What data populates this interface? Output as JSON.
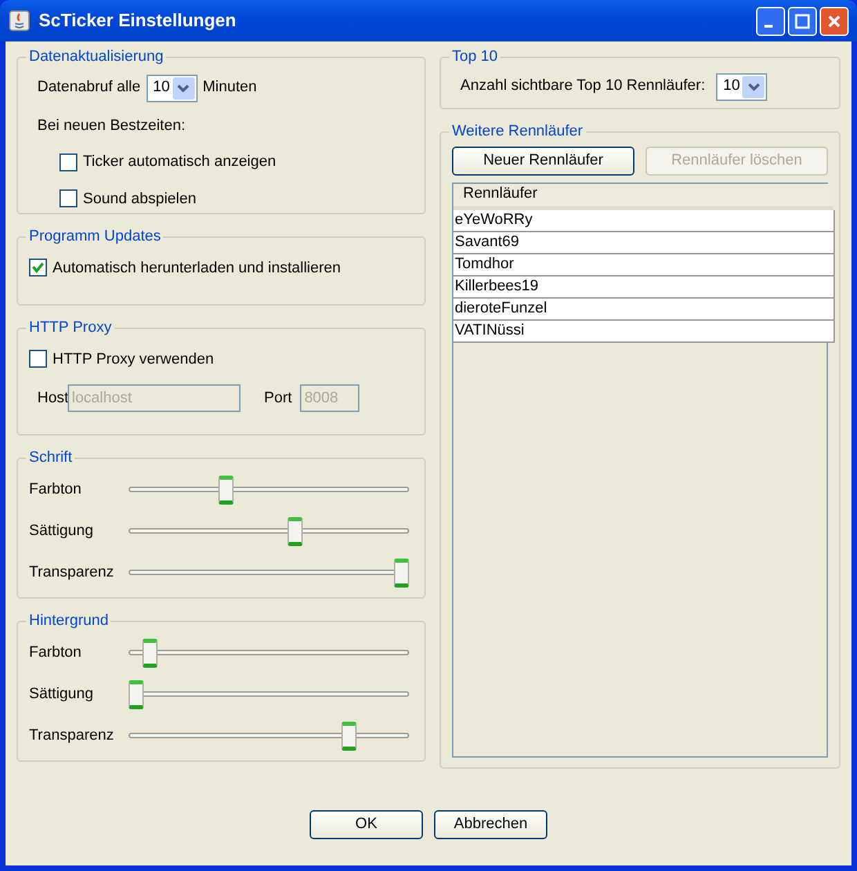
{
  "window": {
    "title": "ScTicker Einstellungen"
  },
  "data_update": {
    "legend": "Datenaktualisierung",
    "interval_label": "Datenabruf alle",
    "interval_value": "10",
    "interval_unit": "Minuten",
    "on_new_label": "Bei neuen Bestzeiten:",
    "options": [
      {
        "label": "Ticker automatisch anzeigen",
        "checked": false
      },
      {
        "label": "Sound abspielen",
        "checked": false
      }
    ]
  },
  "updates": {
    "legend": "Programm Updates",
    "option": {
      "label": "Automatisch herunterladen und installieren",
      "checked": true
    }
  },
  "proxy": {
    "legend": "HTTP Proxy",
    "option": {
      "label": "HTTP Proxy verwenden",
      "checked": false
    },
    "host_label": "Host",
    "host_value": "localhost",
    "port_label": "Port",
    "port_value": "8008"
  },
  "font": {
    "legend": "Schrift",
    "sliders": [
      {
        "label": "Farbton",
        "level": 0.34
      },
      {
        "label": "Sättigung",
        "level": 0.6
      },
      {
        "label": "Transparenz",
        "level": 1.0
      }
    ]
  },
  "background": {
    "legend": "Hintergrund",
    "sliders": [
      {
        "label": "Farbton",
        "level": 0.05
      },
      {
        "label": "Sättigung",
        "level": 0.0
      },
      {
        "label": "Transparenz",
        "level": 0.8
      }
    ]
  },
  "top10": {
    "legend": "Top 10",
    "count_label": "Anzahl sichtbare Top 10 Rennläufer:",
    "count_value": "10"
  },
  "racers": {
    "legend": "Weitere Rennläufer",
    "buttons": [
      {
        "label": "Neuer Rennläufer",
        "disabled": false
      },
      {
        "label": "Rennläufer löschen",
        "disabled": true
      }
    ],
    "column": "Rennläufer",
    "rows": [
      "eYeWoRRy",
      "Savant69",
      "Tomdhor",
      "Killerbees19",
      "dieroteFunzel",
      "VATINüssi"
    ]
  },
  "buttons": [
    "OK",
    "Abbrechen"
  ]
}
